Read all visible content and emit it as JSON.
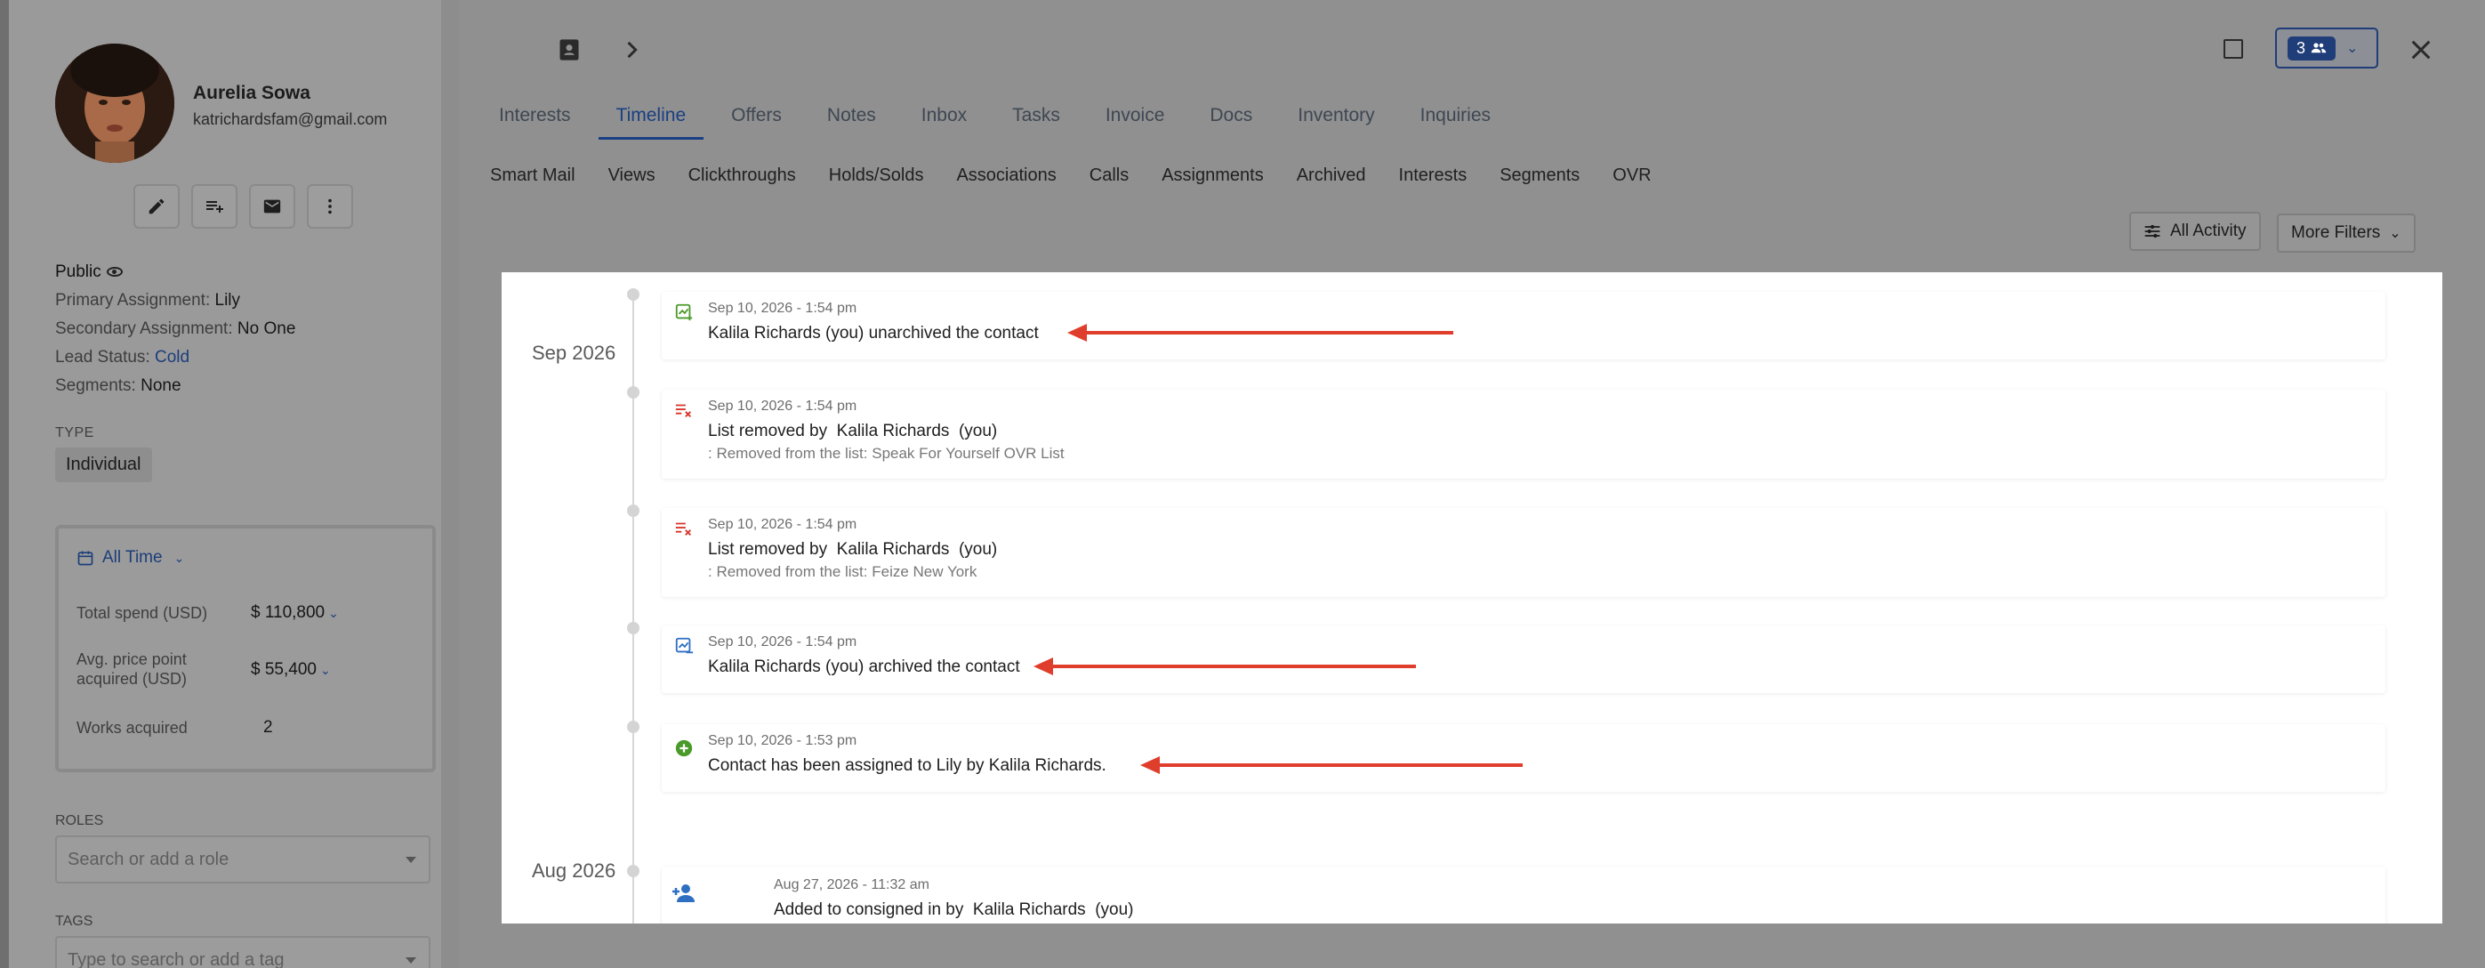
{
  "contact": {
    "name": "Aurelia Sowa",
    "email": "katrichardsfam@gmail.com",
    "visibility": "Public",
    "primary_assignment_label": "Primary Assignment:",
    "primary_assignment": "Lily",
    "secondary_assignment_label": "Secondary Assignment:",
    "secondary_assignment": "No One",
    "lead_status_label": "Lead Status:",
    "lead_status": "Cold",
    "segments_label": "Segments:",
    "segments": "None",
    "type_label": "TYPE",
    "type": "Individual"
  },
  "stats": {
    "period": "All Time",
    "total_spend_label": "Total spend (USD)",
    "total_spend": "$ 110,800",
    "avg_price_label_1": "Avg. price point",
    "avg_price_label_2": "acquired (USD)",
    "avg_price": "$ 55,400",
    "works_label": "Works acquired",
    "works": "2"
  },
  "roles": {
    "label": "ROLES",
    "placeholder": "Search or add a role"
  },
  "tags": {
    "label": "TAGS",
    "placeholder": "Type to search or add a tag"
  },
  "header": {
    "users_count": "3"
  },
  "tabs": [
    "Interests",
    "Timeline",
    "Offers",
    "Notes",
    "Inbox",
    "Tasks",
    "Invoice",
    "Docs",
    "Inventory",
    "Inquiries"
  ],
  "subtabs": [
    "Smart Mail",
    "Views",
    "Clickthroughs",
    "Holds/Solds",
    "Associations",
    "Calls",
    "Assignments",
    "Archived",
    "Interests",
    "Segments",
    "OVR"
  ],
  "filters": {
    "activity": "All Activity",
    "more": "More Filters"
  },
  "timeline": {
    "months": [
      "Sep 2026",
      "Aug 2026"
    ],
    "events": [
      {
        "time": "Sep 10, 2026 - 1:54 pm",
        "text": "Kalila Richards (you) unarchived the contact",
        "icon": "unarchive-icon"
      },
      {
        "time": "Sep 10, 2026 - 1:54 pm",
        "text": "List removed by  Kalila Richards  (you)",
        "sub": ": Removed from the list: Speak For Yourself OVR List",
        "icon": "list-remove-icon"
      },
      {
        "time": "Sep 10, 2026 - 1:54 pm",
        "text": "List removed by  Kalila Richards  (you)",
        "sub": ": Removed from the list: Feize New York",
        "icon": "list-remove-icon"
      },
      {
        "time": "Sep 10, 2026 - 1:54 pm",
        "text": "Kalila Richards (you) archived the contact",
        "icon": "archive-icon"
      },
      {
        "time": "Sep 10, 2026 - 1:53 pm",
        "text": "Contact has been assigned to Lily by Kalila Richards.",
        "icon": "add-circle-icon"
      },
      {
        "time": "Aug 27, 2026 - 11:32 am",
        "text": "Added to consigned in by  Kalila Richards  (you)",
        "icon": "person-add-icon"
      }
    ]
  },
  "colors": {
    "accent": "#1a3f82",
    "arrow": "#e03e2d",
    "success": "#4a9a2a",
    "danger": "#d9342b"
  }
}
